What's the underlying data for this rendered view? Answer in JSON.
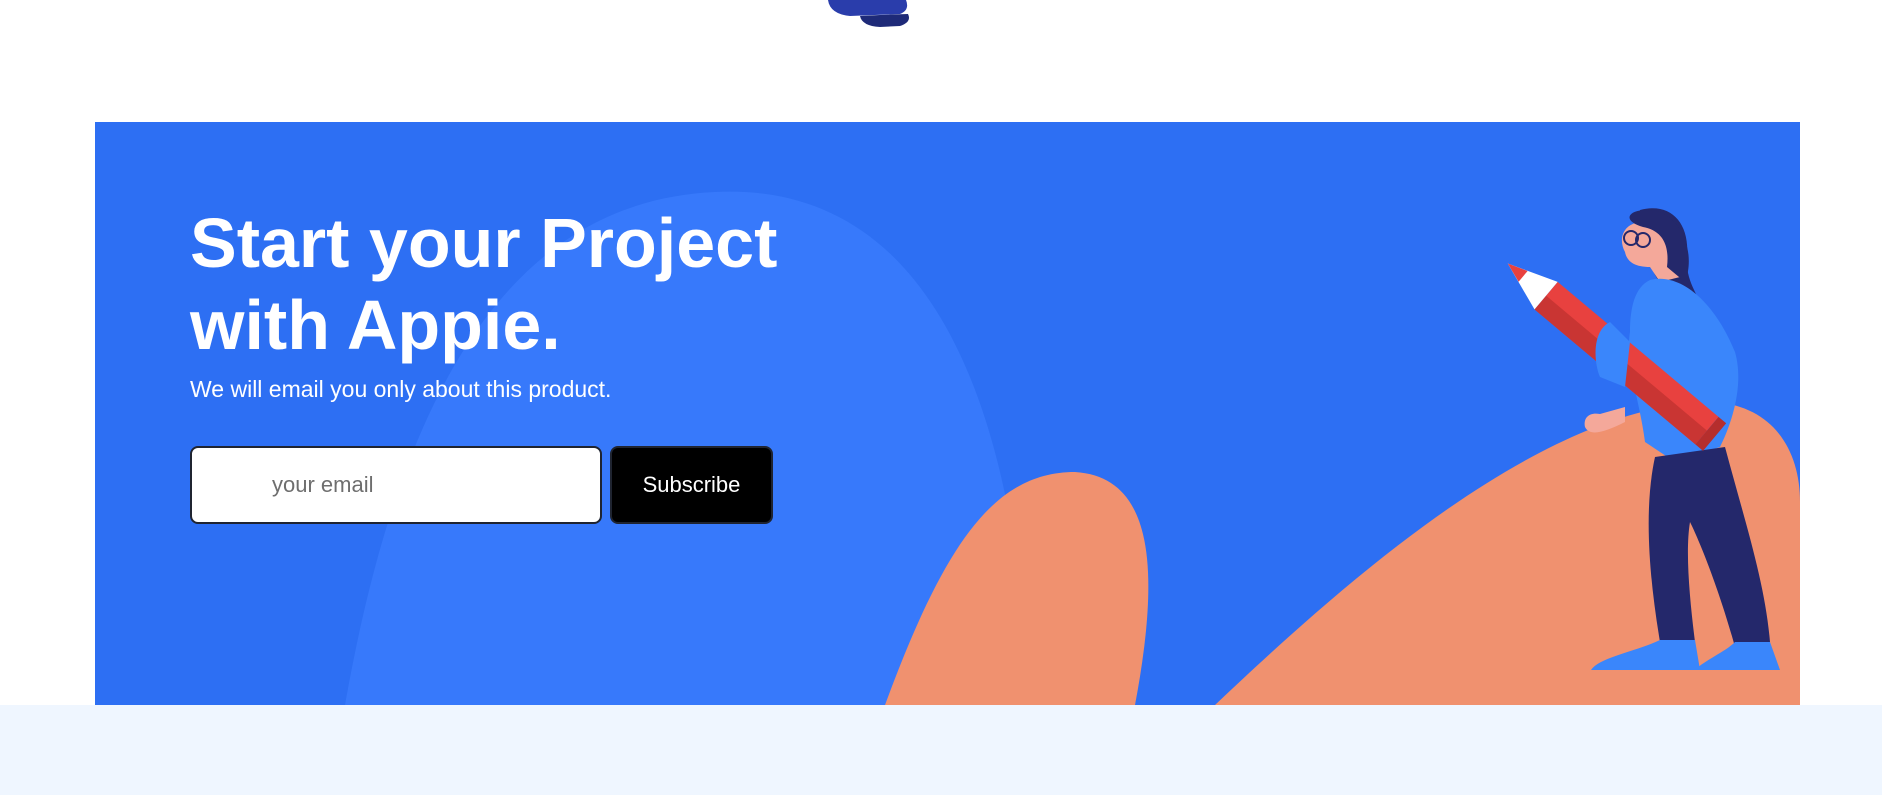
{
  "cta": {
    "headline_line1": "Start your Project",
    "headline_line2": "with Appie.",
    "subtext": "We will email you only about this product.",
    "email_placeholder": "your email",
    "subscribe_label": "Subscribe"
  },
  "colors": {
    "banner_blue": "#2d6ff3",
    "accent_orange": "#f0916f",
    "pencil_red": "#e8413f",
    "button_black": "#000000",
    "footer_bg": "#eff6ff"
  },
  "icons": {
    "illustration": "woman-holding-pencil-illustration",
    "top_feet": "illustration-feet-icon"
  }
}
